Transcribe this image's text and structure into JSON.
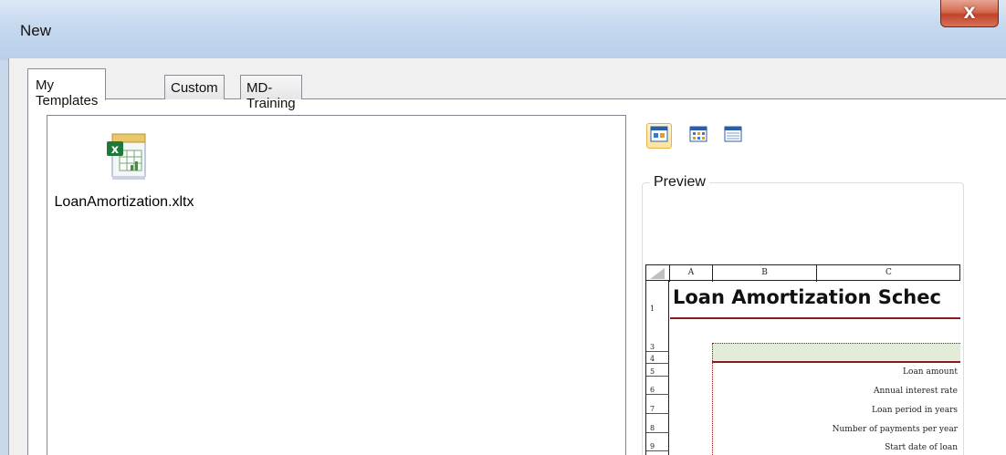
{
  "window": {
    "title": "New",
    "close_glyph": "X"
  },
  "tabs": [
    {
      "label": "My Templates",
      "active": true
    },
    {
      "label": "Custom",
      "active": false
    },
    {
      "label": "MD-Training",
      "active": false
    }
  ],
  "files": [
    {
      "name": "LoanAmortization.xltx",
      "icon": "excel-template-icon"
    }
  ],
  "view_buttons": [
    {
      "name": "large-icons-view-icon",
      "selected": true
    },
    {
      "name": "list-view-icon",
      "selected": false
    },
    {
      "name": "details-view-icon",
      "selected": false
    }
  ],
  "preview": {
    "label": "Preview",
    "columns": [
      "A",
      "B",
      "C"
    ],
    "rows": [
      "1",
      "3",
      "4",
      "5",
      "6",
      "7",
      "8",
      "9"
    ],
    "title": "Loan Amortization Schec",
    "input_labels": [
      "Loan amount",
      "Annual interest rate",
      "Loan period in years",
      "Number of payments per year",
      "Start date of loan"
    ]
  },
  "colors": {
    "accent_red": "#8b1a1a",
    "band_green": "#e3ecd8",
    "close_red": "#c2432a"
  }
}
